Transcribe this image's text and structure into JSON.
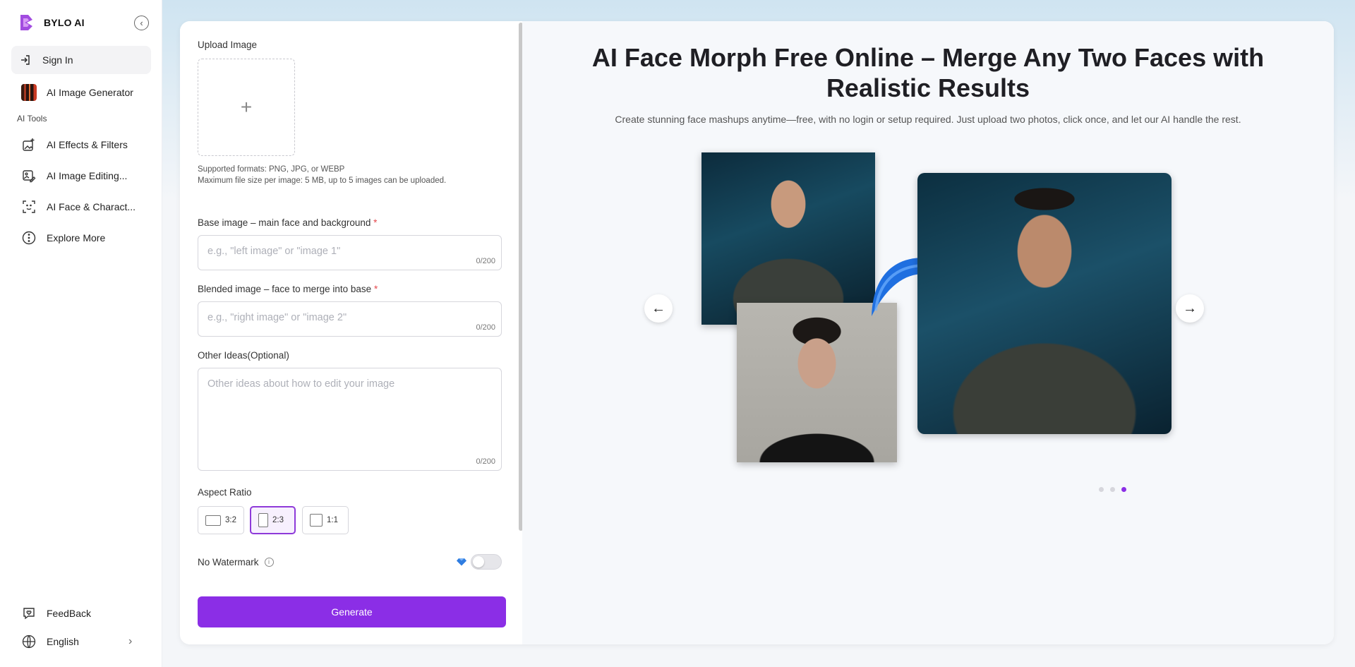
{
  "brand": {
    "name": "BYLO AI"
  },
  "sidebar": {
    "sign_in": "Sign In",
    "generator": "AI Image Generator",
    "section_label": "AI Tools",
    "items": [
      {
        "label": "AI Effects & Filters",
        "icon": "sparkle-image-icon"
      },
      {
        "label": "AI Image Editing...",
        "icon": "image-edit-icon"
      },
      {
        "label": "AI Face & Charact...",
        "icon": "face-scan-icon"
      },
      {
        "label": "Explore More",
        "icon": "more-dots-icon"
      }
    ],
    "feedback": "FeedBack",
    "language": "English"
  },
  "form": {
    "upload_label": "Upload Image",
    "upload_plus": "+",
    "formats_hint": "Supported formats: PNG, JPG, or WEBP",
    "size_hint": "Maximum file size per image: 5 MB, up to 5 images can be uploaded.",
    "base_label": "Base image – main face and background",
    "base_placeholder": "e.g., \"left image\" or \"image 1\"",
    "base_count": "0/200",
    "blend_label": "Blended image – face to merge into base",
    "blend_placeholder": "e.g., \"right image\" or \"image 2\"",
    "blend_count": "0/200",
    "other_label": "Other Ideas(Optional)",
    "other_placeholder": "Other ideas about how to edit your image",
    "other_count": "0/200",
    "required_mark": "*",
    "aspect_label": "Aspect Ratio",
    "ratios": [
      "3:2",
      "2:3",
      "1:1"
    ],
    "selected_ratio": "2:3",
    "watermark_label": "No Watermark",
    "watermark_on": false,
    "generate": "Generate"
  },
  "hero": {
    "title": "AI Face Morph Free Online – Merge Any Two Faces with Realistic Results",
    "subtitle": "Create stunning face mashups anytime—free, with no login or setup required. Just upload two photos, click once, and let our AI handle the rest.",
    "prev": "←",
    "next": "→",
    "slides_total": 3,
    "active_slide": 3
  },
  "colors": {
    "accent": "#8b2ee6",
    "arrow_blue": "#1f6fe0"
  }
}
